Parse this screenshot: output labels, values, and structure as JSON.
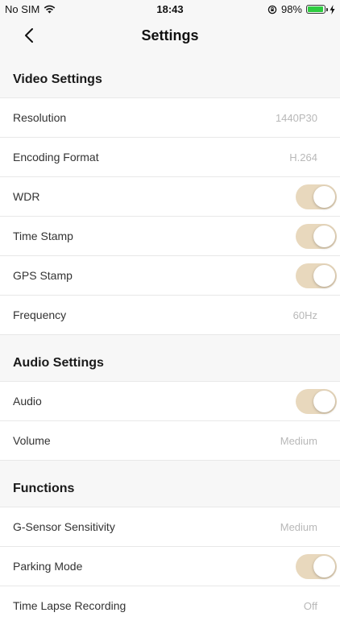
{
  "status": {
    "carrier": "No SIM",
    "time": "18:43",
    "battery": "98%"
  },
  "nav": {
    "title": "Settings"
  },
  "sections": [
    {
      "title": "Video Settings",
      "rows": [
        {
          "label": "Resolution",
          "value": "1440P30"
        },
        {
          "label": "Encoding Format",
          "value": "H.264"
        },
        {
          "label": "WDR",
          "toggle": true
        },
        {
          "label": "Time Stamp",
          "toggle": true
        },
        {
          "label": "GPS Stamp",
          "toggle": true
        },
        {
          "label": "Frequency",
          "value": "60Hz"
        }
      ]
    },
    {
      "title": "Audio Settings",
      "rows": [
        {
          "label": "Audio",
          "toggle": true
        },
        {
          "label": "Volume",
          "value": "Medium"
        }
      ]
    },
    {
      "title": "Functions",
      "rows": [
        {
          "label": "G-Sensor Sensitivity",
          "value": "Medium"
        },
        {
          "label": "Parking Mode",
          "toggle": true
        },
        {
          "label": "Time Lapse Recording",
          "value": "Off"
        }
      ]
    }
  ],
  "colors": {
    "toggle_on": "#e8d8bd",
    "value_text": "#b8b8b8",
    "background": "#f7f7f7"
  }
}
